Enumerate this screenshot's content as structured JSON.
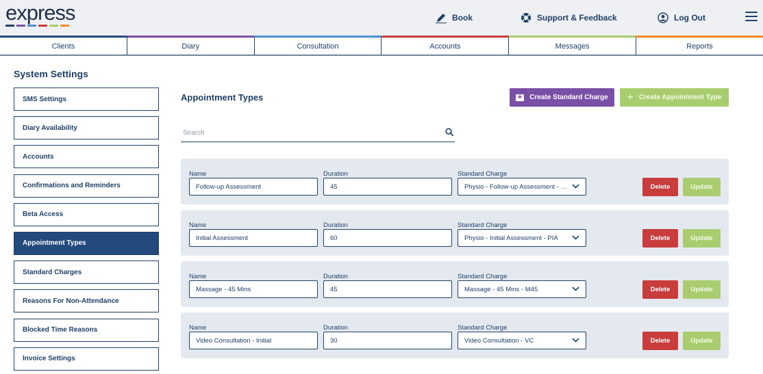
{
  "brand": {
    "logo_text": "express",
    "logo_colors": [
      "#1f3f66",
      "#7a4fa6",
      "#4a8fd6",
      "#c83c3c",
      "#a9cd6e",
      "#f08a2b"
    ]
  },
  "header": {
    "book_label": "Book",
    "support_label": "Support & Feedback",
    "logout_label": "Log Out",
    "strip_colors": [
      "#234a7c",
      "#7a4fa6",
      "#4a8fd6",
      "#c83c3c",
      "#a9cd6e",
      "#f08a2b"
    ]
  },
  "nav": {
    "tabs": [
      {
        "label": "Clients"
      },
      {
        "label": "Diary"
      },
      {
        "label": "Consultation"
      },
      {
        "label": "Accounts"
      },
      {
        "label": "Messages"
      },
      {
        "label": "Reports"
      }
    ]
  },
  "sidebar": {
    "title": "System Settings",
    "active_index": 5,
    "items": [
      {
        "label": "SMS Settings"
      },
      {
        "label": "Diary Availability"
      },
      {
        "label": "Accounts"
      },
      {
        "label": "Confirmations and Reminders"
      },
      {
        "label": "Beta Access"
      },
      {
        "label": "Appointment Types"
      },
      {
        "label": "Standard Charges"
      },
      {
        "label": "Reasons For Non-Attendance"
      },
      {
        "label": "Blocked Time Reasons"
      },
      {
        "label": "Invoice Settings"
      }
    ]
  },
  "main": {
    "title": "Appointment Types",
    "create_standard_charge_label": "Create Standard Charge",
    "create_appointment_type_label": "Create Appointment Type",
    "search": {
      "placeholder": "Search",
      "value": ""
    },
    "labels": {
      "name": "Name",
      "duration": "Duration",
      "standard_charge": "Standard Charge"
    },
    "delete_label": "Delete",
    "update_label": "Update",
    "rows": [
      {
        "name": "Follow-up Assessment",
        "duration": "45",
        "standard_charge": "Physio - Follow-up Assessment - PFA"
      },
      {
        "name": "Initial Assessment",
        "duration": "60",
        "standard_charge": "Physio - Initial Assessment - PIA"
      },
      {
        "name": "Massage - 45 Mins",
        "duration": "45",
        "standard_charge": "Massage - 45 Mins - M45"
      },
      {
        "name": "Video Consultation - Initial",
        "duration": "30",
        "standard_charge": "Video Consultation - VC"
      }
    ]
  }
}
